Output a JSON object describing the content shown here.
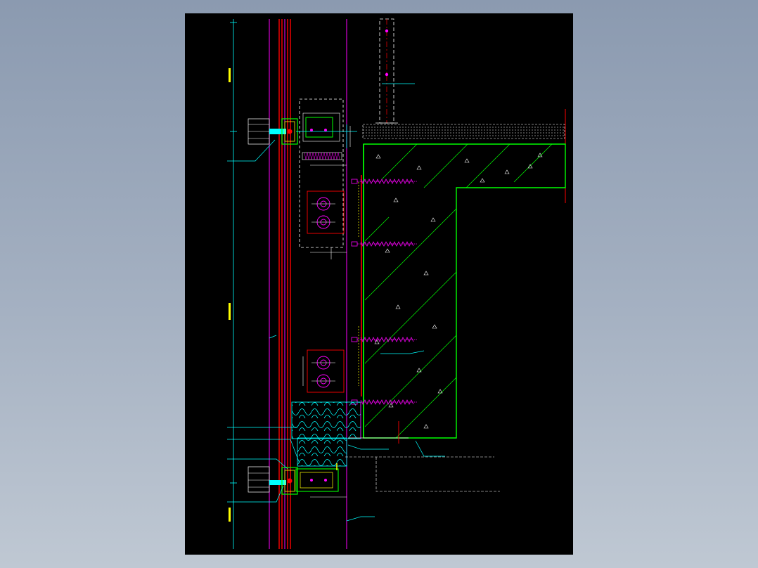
{
  "viewer": {
    "background": "#a5b1c2",
    "sheet_background": "#000000"
  },
  "colors": {
    "magenta": "#ff00ff",
    "red": "#ff0000",
    "green": "#00ff00",
    "cyan": "#00ffff",
    "yellow": "#ffff00",
    "white": "#ffffff"
  },
  "callouts": {
    "top_right": "",
    "left_upper": "",
    "left_middle_1": "",
    "left_middle_2": "",
    "left_middle_3": "",
    "right_middle": "",
    "left_lower_1": "",
    "left_lower_2": "",
    "left_lower_3": "",
    "left_lower_4": "",
    "bottom_center": "",
    "right_lower": "",
    "bottom_right": "",
    "detail_tag": ""
  }
}
